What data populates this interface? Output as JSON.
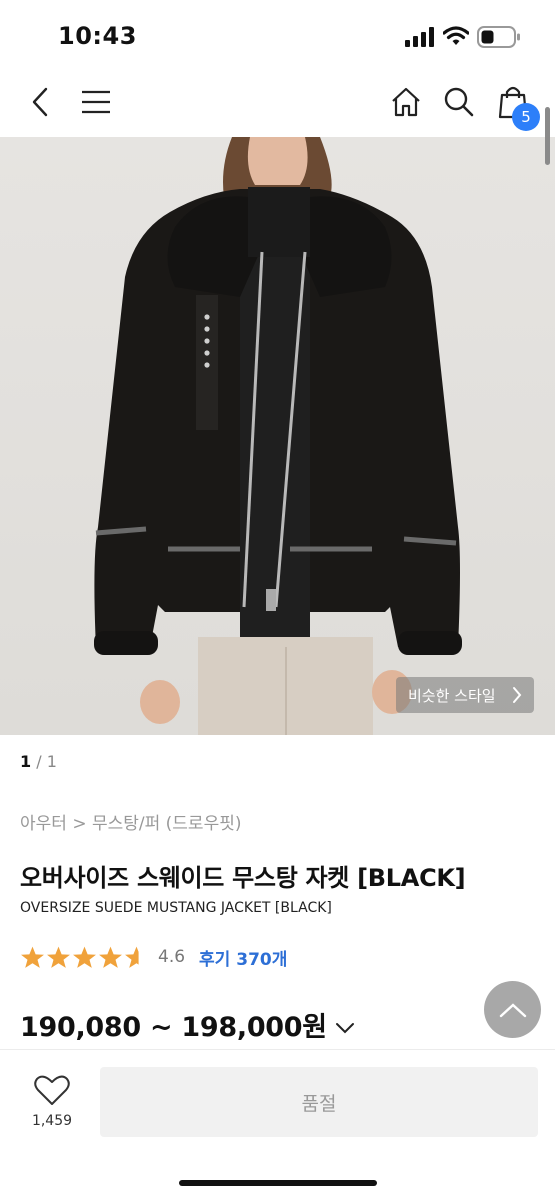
{
  "status_bar": {
    "time": "10:43",
    "icons": [
      "signal-icon",
      "wifi-icon",
      "battery-icon"
    ]
  },
  "nav": {
    "icons": [
      "back-icon",
      "menu-icon",
      "home-icon",
      "search-icon",
      "shopping-bag-icon"
    ],
    "cart_badge": "5",
    "accent_color": "#2d7ff9"
  },
  "hero": {
    "similar_style_label": "비슷한 스타일"
  },
  "pager": {
    "current": "1",
    "separator": " / ",
    "total": "1"
  },
  "product": {
    "breadcrumb": "아우터 > 무스탕/퍼 (드로우핏)",
    "title_ko": "오버사이즈 스웨이드 무스탕 자켓 [BLACK]",
    "title_en": "OVERSIZE SUEDE MUSTANG JACKET [BLACK]",
    "rating": "4.6",
    "rating_stars": 4.6,
    "star_color": "#f0a23b",
    "review_label": "후기 370개",
    "review_color": "#2d6fd6",
    "price": "190,080 ~ 198,000원"
  },
  "bottom_bar": {
    "like_count": "1,459",
    "soldout_label": "품절"
  }
}
